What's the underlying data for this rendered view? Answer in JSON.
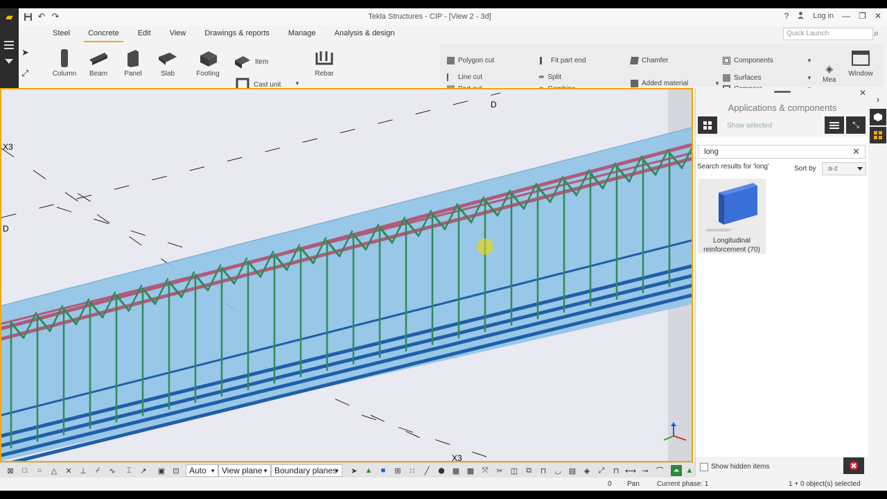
{
  "window": {
    "title": "Tekla Structures - CIP  - [View 2 - 3d]",
    "login": "Log in",
    "help": "?",
    "minimize": "—",
    "maximize": "❐",
    "close": "✕"
  },
  "menu": {
    "tabs": [
      "Steel",
      "Concrete",
      "Edit",
      "View",
      "Drawings & reports",
      "Manage",
      "Analysis & design"
    ],
    "active_tab": "Concrete",
    "quick_launch_placeholder": "Quick Launch"
  },
  "ribbon": {
    "column": "Column",
    "beam": "Beam",
    "panel": "Panel",
    "slab": "Slab",
    "footing": "Footing",
    "item": "Item",
    "cast_unit": "Cast unit",
    "rebar": "Rebar",
    "polygon_cut": "Polygon cut",
    "line_cut": "Line cut",
    "part_cut": "Part cut",
    "fit_part_end": "Fit part end",
    "split": "Split",
    "combine": "Combine",
    "chamfer": "Chamfer",
    "added_material": "Added material",
    "components": "Components",
    "surfaces": "Surfaces",
    "compare": "Compare",
    "measure": "Mea",
    "window": "Window"
  },
  "viewport": {
    "grid_labels": {
      "x3_left": "X3",
      "d_left": "D",
      "d_top": "D",
      "x3_bottom": "X3"
    },
    "colors": {
      "concrete": "#8fc3e6",
      "stirrup": "#2e8b57",
      "top_bar": "#b05a7a",
      "bottom_bar": "#1f5fa8",
      "highlight": "#f0a800"
    }
  },
  "panel": {
    "title": "Applications & components",
    "show_selected": "Show selected",
    "search_value": "long",
    "search_results": "Search results for 'long'",
    "sort_by": "Sort by",
    "sort_value": "a-z",
    "card_label": "Longitudinal reinforcement (70)",
    "show_hidden": "Show hidden items"
  },
  "bottombar": {
    "auto": "Auto",
    "view_plane": "View plane",
    "boundary_planes": "Boundary planes"
  },
  "status": {
    "zero": "0",
    "mode": "Pan",
    "phase": "Current phase: 1",
    "selection": "1 + 0 object(s) selected"
  }
}
